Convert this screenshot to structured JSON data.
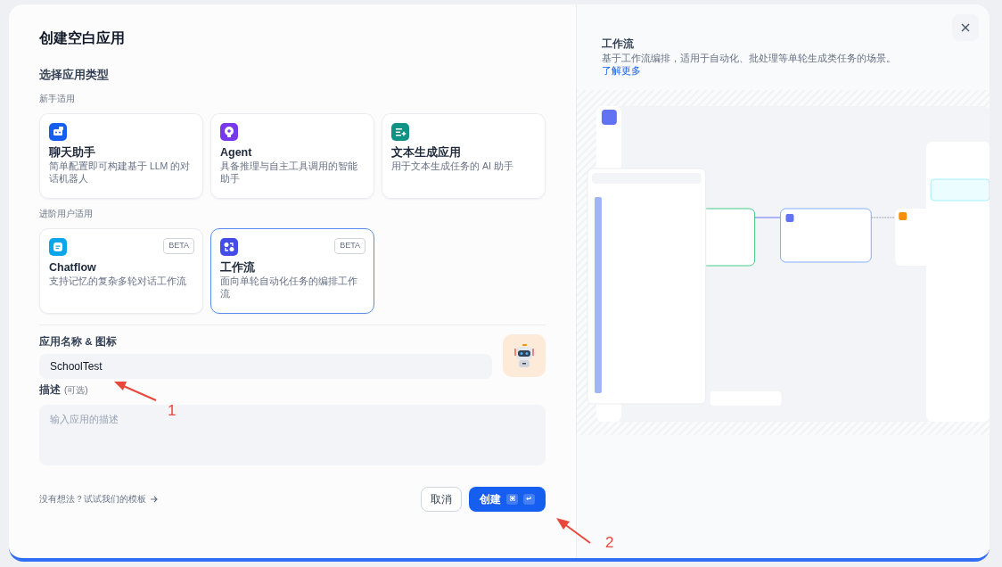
{
  "title": "创建空白应用",
  "section_title": "选择应用类型",
  "groups": [
    {
      "label": "新手适用",
      "types": [
        {
          "color": "#155eef",
          "title": "聊天助手",
          "desc": "简单配置即可构建基于 LLM 的对话机器人",
          "selected": false
        },
        {
          "color": "#7839ee",
          "title": "Agent",
          "desc": "具备推理与自主工具调用的智能助手",
          "selected": false
        },
        {
          "color": "#0e9384",
          "title": "文本生成应用",
          "desc": "用于文本生成任务的 AI 助手",
          "selected": false
        }
      ]
    },
    {
      "label": "进阶用户适用",
      "types": [
        {
          "color": "#0ba5ec",
          "title": "Chatflow",
          "desc": "支持记忆的复杂多轮对话工作流",
          "badge": "BETA",
          "selected": false
        },
        {
          "color": "#444ce7",
          "title": "工作流",
          "desc": "面向单轮自动化任务的编排工作流",
          "badge": "BETA",
          "selected": true
        }
      ]
    }
  ],
  "name_label": "应用名称 & 图标",
  "name_value": "SchoolTest",
  "desc_label": "描述",
  "desc_optional": "(可选)",
  "desc_placeholder": "输入应用的描述",
  "template_link": "没有想法？试试我们的模板",
  "cancel": "取消",
  "create": "创建",
  "create_keys": [
    "⌘",
    "↵"
  ],
  "preview": {
    "title": "工作流",
    "desc": "基于工作流编排，适用于自动化、批处理等单轮生成类任务的场景。",
    "link": "了解更多"
  },
  "annotations": [
    {
      "label": "1"
    },
    {
      "label": "2"
    }
  ]
}
